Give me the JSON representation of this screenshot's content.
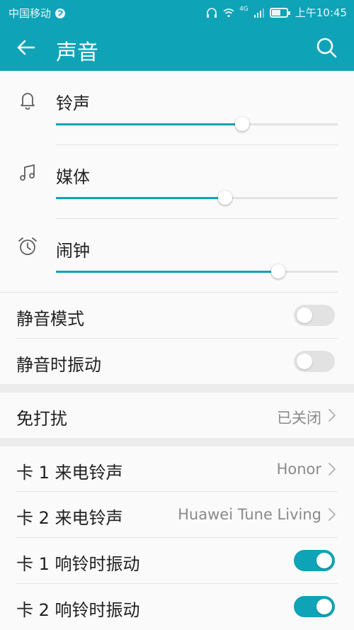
{
  "status_bar": {
    "carrier": "中国移动",
    "network": "4G",
    "time": "上午10:45"
  },
  "app_bar": {
    "title": "声音",
    "back_icon": "arrow-left-icon",
    "search_icon": "search-icon"
  },
  "volumes": [
    {
      "label": "铃声",
      "icon": "bell-icon",
      "level": 0.66
    },
    {
      "label": "媒体",
      "icon": "music-note-icon",
      "level": 0.6
    },
    {
      "label": "闹钟",
      "icon": "alarm-clock-icon",
      "level": 0.79
    }
  ],
  "toggles_group1": [
    {
      "label": "静音模式",
      "on": false
    },
    {
      "label": "静音时振动",
      "on": false
    }
  ],
  "dnd": {
    "label": "免打扰",
    "value": "已关闭"
  },
  "ringtones": [
    {
      "label": "卡 1 来电铃声",
      "value": "Honor"
    },
    {
      "label": "卡 2 来电铃声",
      "value": "Huawei Tune Living"
    }
  ],
  "toggles_group2": [
    {
      "label": "卡 1 响铃时振动",
      "on": true
    },
    {
      "label": "卡 2 响铃时振动",
      "on": true
    }
  ],
  "colors": {
    "accent": "#0fa3b7",
    "switch_off": "#e2e2e2",
    "text": "#212121",
    "secondary_text": "#8a8a8a"
  }
}
